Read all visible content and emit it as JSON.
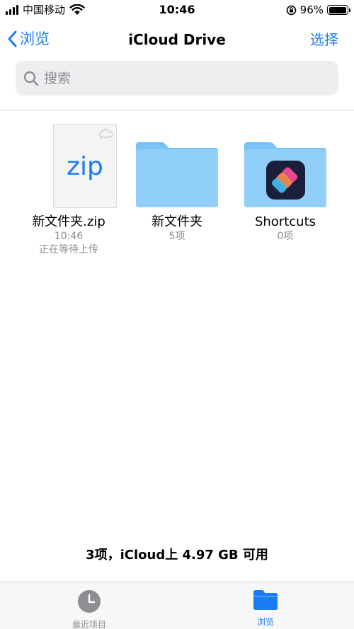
{
  "status_bar": {
    "carrier": "中国移动",
    "time": "10:46",
    "battery_percent": "96%",
    "battery_level": 0.96
  },
  "nav": {
    "back_label": "浏览",
    "title": "iCloud Drive",
    "select_label": "选择"
  },
  "search": {
    "placeholder": "搜索"
  },
  "items": [
    {
      "name": "新文件夹.zip",
      "meta1": "10:46",
      "meta2": "正在等待上传",
      "icon": "zip-file-icon"
    },
    {
      "name": "新文件夹",
      "meta1": "5项",
      "icon": "folder-icon"
    },
    {
      "name": "Shortcuts",
      "meta1": "0项",
      "icon": "shortcuts-folder-icon"
    }
  ],
  "footer": {
    "summary": "3项，iCloud上 4.97 GB 可用"
  },
  "tabbar": {
    "recents_label": "最近项目",
    "browse_label": "浏览"
  },
  "colors": {
    "accent": "#1a7cf5",
    "folder": "#86c9f7",
    "secondary_text": "#8e8e93"
  }
}
